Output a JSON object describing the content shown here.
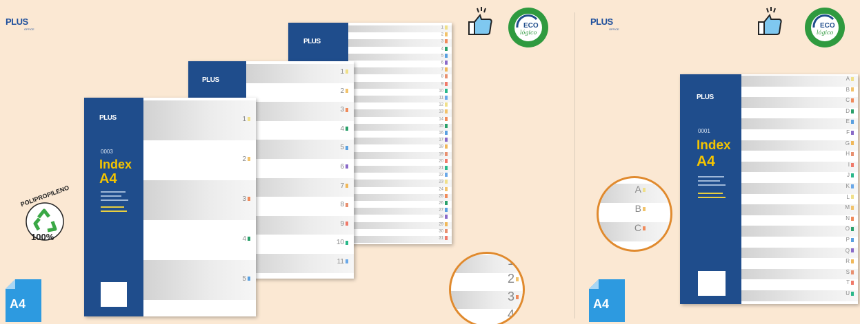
{
  "left_panel": {
    "brand_logo": {
      "text": "PLUS",
      "sub": "OFFICE"
    },
    "format_badge": "A4",
    "polypropylene_badge": {
      "arc_text": "POLIPROPILENO",
      "percent": "100%"
    },
    "eco_badge": {
      "title": "ECO",
      "script": "lógico",
      "ring_text": "producto sostenible"
    },
    "divider_sets": [
      {
        "cover": {
          "brand": "PLUS",
          "code": "",
          "title1": "",
          "title2": ""
        },
        "tabs": [
          "1",
          "2",
          "3",
          "4",
          "5",
          "6",
          "7",
          "8",
          "9",
          "10",
          "11",
          "12",
          "13",
          "14",
          "15",
          "16",
          "17",
          "18",
          "19",
          "20",
          "21",
          "22",
          "23",
          "24",
          "25",
          "26",
          "27",
          "28",
          "29",
          "30",
          "31"
        ]
      },
      {
        "cover": {
          "brand": "PLUS",
          "code": "",
          "title1": "",
          "title2": ""
        },
        "tabs": [
          "1",
          "2",
          "3",
          "4",
          "5",
          "6",
          "7",
          "8",
          "9",
          "10",
          "11"
        ]
      },
      {
        "cover": {
          "brand": "PLUS",
          "code": "0003",
          "title1": "Index",
          "title2": "A4"
        },
        "tabs": [
          "1",
          "2",
          "3",
          "4",
          "5"
        ]
      }
    ],
    "magnifier_tabs": [
      "1",
      "2",
      "3",
      "4"
    ]
  },
  "right_panel": {
    "brand_logo": {
      "text": "PLUS",
      "sub": "OFFICE"
    },
    "format_badge": "A4",
    "eco_badge": {
      "title": "ECO",
      "script": "lógico",
      "ring_text": "producto sostenible"
    },
    "divider_set": {
      "cover": {
        "brand": "PLUS",
        "code": "0001",
        "title1": "Index",
        "title2": "A4"
      },
      "tabs": [
        "A",
        "B",
        "C",
        "D",
        "E",
        "F",
        "G",
        "H",
        "I",
        "J",
        "K",
        "L",
        "M",
        "N",
        "O",
        "P",
        "Q",
        "R",
        "S",
        "T",
        "U"
      ]
    },
    "magnifier_tabs": [
      "A",
      "B",
      "C"
    ]
  },
  "colors": {
    "background": "#fbe8d3",
    "cover_blue": "#1f4d8c",
    "index_yellow": "#f4c400",
    "eco_green": "#2f9a3f",
    "highlight_orange": "#e08a2e",
    "tab_dots": [
      "#f0e08a",
      "#f2c36b",
      "#f08a5a",
      "#2aa06a",
      "#5aa0e0",
      "#8a6ac8",
      "#f0b85a",
      "#e89070",
      "#f07a6a",
      "#2ab88a",
      "#6aa8e8"
    ]
  }
}
